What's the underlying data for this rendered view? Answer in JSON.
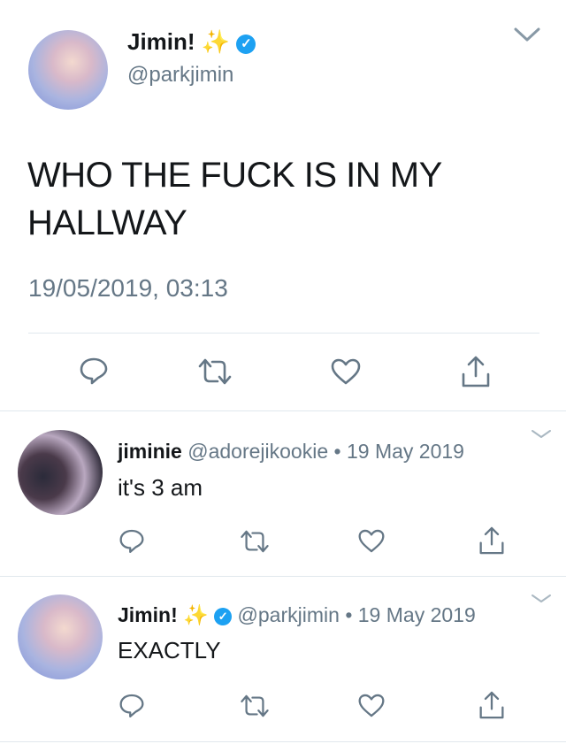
{
  "main_tweet": {
    "name": "Jimin!",
    "name_emoji": "✨",
    "handle": "@parkjimin",
    "text_line1": "WHO THE FUCK IS IN MY",
    "text_line2": "HALLWAY",
    "timestamp": "19/05/2019, 03:13"
  },
  "replies": [
    {
      "name": "jiminie",
      "handle": "@adorejikookie",
      "separator": "•",
      "date": "19 May 2019",
      "text": "it's 3 am"
    },
    {
      "name": "Jimin!",
      "name_emoji": "✨",
      "handle": "@parkjimin",
      "separator": "•",
      "date": "19 May 2019",
      "text": "EXACTLY"
    }
  ],
  "icons": [
    "reply-icon",
    "retweet-icon",
    "like-icon",
    "share-icon",
    "chevron-down-icon",
    "verified-icon",
    "sparkles-emoji"
  ],
  "colors": {
    "verified_blue": "#1da1f2",
    "icon_gray": "#657786",
    "text": "#14171a",
    "divider": "#e1e8ed"
  }
}
